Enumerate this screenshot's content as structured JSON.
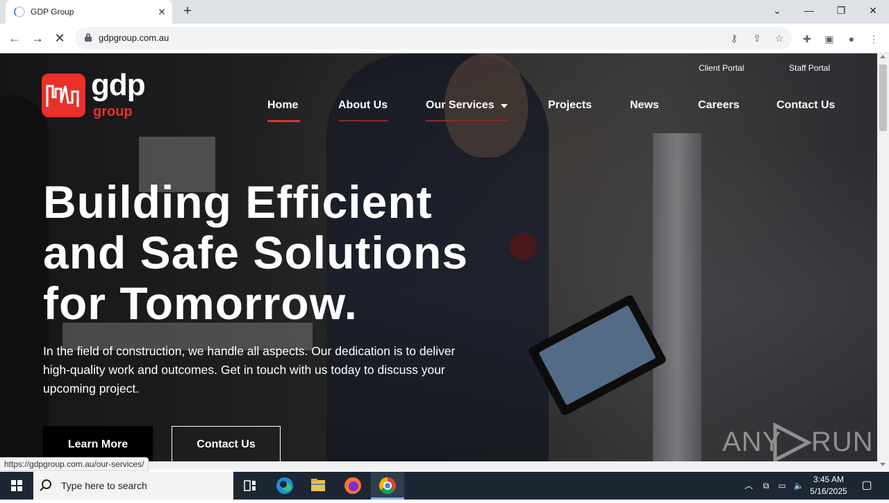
{
  "browser": {
    "tab_title": "GDP Group",
    "url": "gdpgroup.com.au",
    "status_url": "https://gdpgroup.com.au/our-services/"
  },
  "site": {
    "logo_main": "gdp",
    "logo_sub": "group",
    "portals": [
      "Client Portal",
      "Staff Portal"
    ],
    "nav": [
      "Home",
      "About Us",
      "Our Services",
      "Projects",
      "News",
      "Careers",
      "Contact Us"
    ],
    "active_nav": "Home",
    "brand_color": "#e8302c",
    "hero": {
      "title_lines": [
        "Building Efficient",
        "and Safe Solutions",
        "for Tomorrow."
      ],
      "text_lines": [
        "In the field of construction, we handle all aspects. Our dedication is to deliver",
        "high-quality work and outcomes. Get in touch with us today to discuss your",
        "upcoming project."
      ],
      "primary_button": "Learn More",
      "secondary_button": "Contact Us"
    },
    "watermark": [
      "ANY",
      "RUN"
    ]
  },
  "taskbar": {
    "search_placeholder": "Type here to search",
    "time": "3:45 AM",
    "date": "5/16/2025"
  }
}
